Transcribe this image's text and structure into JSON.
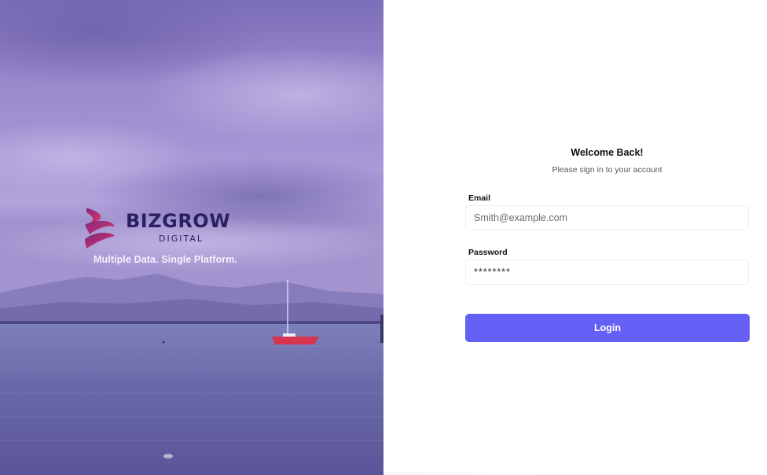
{
  "hero": {
    "brand_name": "BIZGROW",
    "brand_sub": "DIGITAL",
    "tagline": "Multiple Data. Single Platform.",
    "logo_icon": "bizgrow-logo-icon",
    "colors": {
      "brand_dark": "#2a2163",
      "brand_gradient": [
        "#7b2a7f",
        "#e2336b"
      ]
    }
  },
  "login": {
    "title": "Welcome Back!",
    "subtitle": "Please sign in to your account",
    "email": {
      "label": "Email",
      "placeholder": "Smith@example.com",
      "value": ""
    },
    "password": {
      "label": "Password",
      "value": "********"
    },
    "submit_label": "Login",
    "colors": {
      "button": "#6460f5"
    }
  }
}
